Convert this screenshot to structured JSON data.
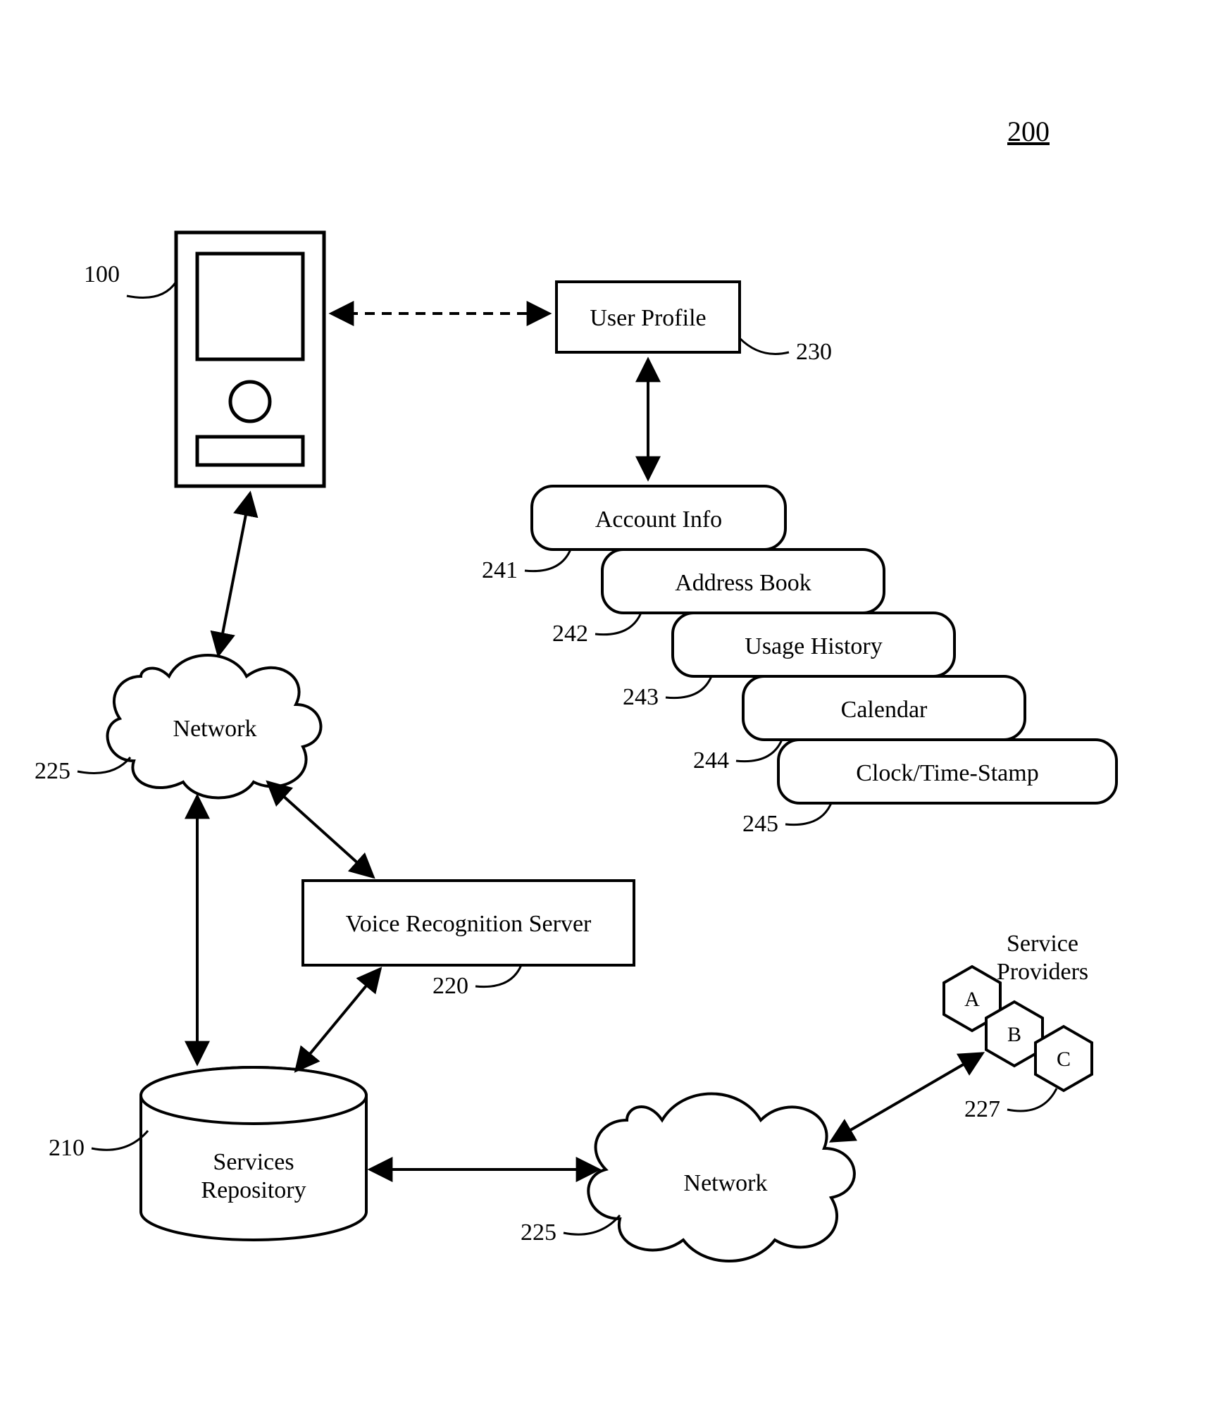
{
  "figure_number": "200",
  "device_ref": "100",
  "user_profile": {
    "label": "User Profile",
    "ref": "230"
  },
  "profile_items": [
    {
      "label": "Account Info",
      "ref": "241"
    },
    {
      "label": "Address Book",
      "ref": "242"
    },
    {
      "label": "Usage History",
      "ref": "243"
    },
    {
      "label": "Calendar",
      "ref": "244"
    },
    {
      "label": "Clock/Time-Stamp",
      "ref": "245"
    }
  ],
  "network1": {
    "label": "Network",
    "ref": "225"
  },
  "vr_server": {
    "label": "Voice Recognition Server",
    "ref": "220"
  },
  "repo": {
    "label1": "Services",
    "label2": "Repository",
    "ref": "210"
  },
  "network2": {
    "label": "Network",
    "ref": "225"
  },
  "providers": {
    "title1": "Service",
    "title2": "Providers",
    "a": "A",
    "b": "B",
    "c": "C",
    "ref": "227"
  }
}
